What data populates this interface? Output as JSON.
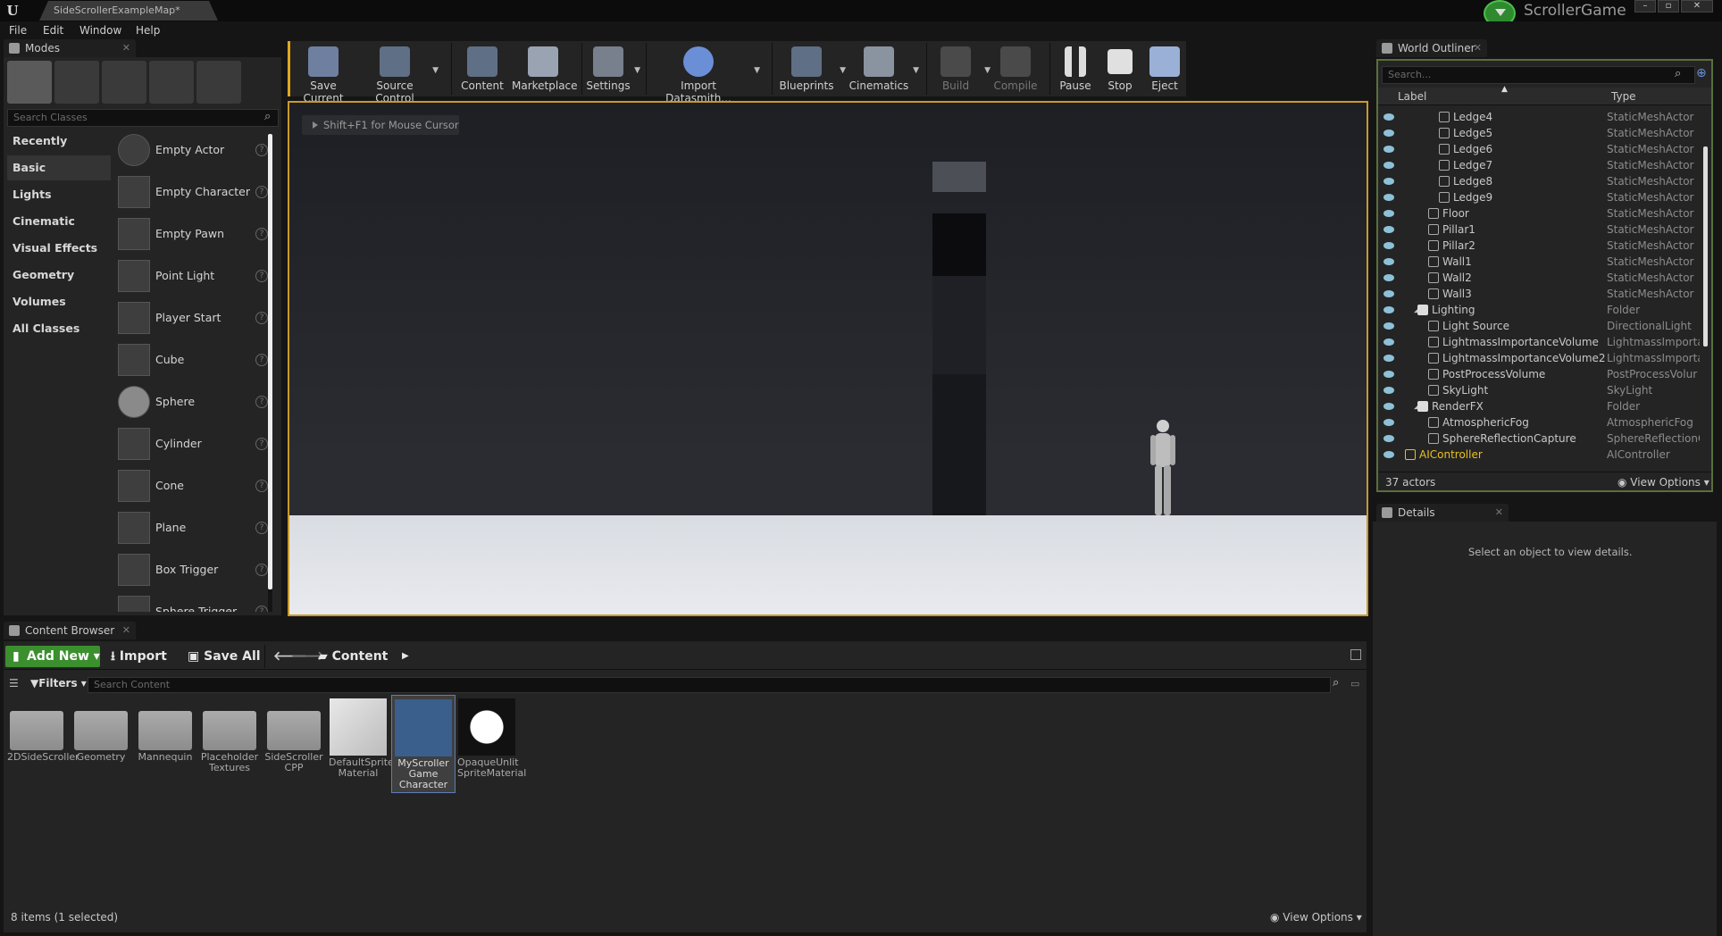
{
  "title_bar": {
    "tab": "SideScrollerExampleMap*",
    "game": "ScrollerGame",
    "minimize": "–",
    "maximize": "▫",
    "close": "✕"
  },
  "menu": [
    "File",
    "Edit",
    "Window",
    "Help"
  ],
  "modes": {
    "tab": "Modes",
    "search_placeholder": "Search Classes",
    "categories": [
      "Recently Placed",
      "Basic",
      "Lights",
      "Cinematic",
      "Visual Effects",
      "Geometry",
      "Volumes",
      "All Classes"
    ],
    "selected_category": "Basic",
    "items": [
      "Empty Actor",
      "Empty Character",
      "Empty Pawn",
      "Point Light",
      "Player Start",
      "Cube",
      "Sphere",
      "Cylinder",
      "Cone",
      "Plane",
      "Box Trigger",
      "Sphere Trigger"
    ]
  },
  "toolbar": [
    "Save Current",
    "Source Control",
    "Content",
    "Marketplace",
    "Settings",
    "Import Datasmith...",
    "Blueprints",
    "Cinematics",
    "Build",
    "Compile",
    "Pause",
    "Stop",
    "Eject"
  ],
  "viewport": {
    "hint": "Shift+F1 for Mouse Cursor"
  },
  "outliner": {
    "tab": "World Outliner",
    "search_placeholder": "Search...",
    "col_label": "Label",
    "col_type": "Type",
    "rows": [
      {
        "label": "Ledge4",
        "type": "StaticMeshActor"
      },
      {
        "label": "Ledge5",
        "type": "StaticMeshActor"
      },
      {
        "label": "Ledge6",
        "type": "StaticMeshActor"
      },
      {
        "label": "Ledge7",
        "type": "StaticMeshActor"
      },
      {
        "label": "Ledge8",
        "type": "StaticMeshActor"
      },
      {
        "label": "Ledge9",
        "type": "StaticMeshActor"
      },
      {
        "label": "Floor",
        "type": "StaticMeshActor"
      },
      {
        "label": "Pillar1",
        "type": "StaticMeshActor"
      },
      {
        "label": "Pillar2",
        "type": "StaticMeshActor"
      },
      {
        "label": "Wall1",
        "type": "StaticMeshActor"
      },
      {
        "label": "Wall2",
        "type": "StaticMeshActor"
      },
      {
        "label": "Wall3",
        "type": "StaticMeshActor"
      },
      {
        "label": "Lighting",
        "type": "Folder"
      },
      {
        "label": "Light Source",
        "type": "DirectionalLight"
      },
      {
        "label": "LightmassImportanceVolume",
        "type": "LightmassImporta"
      },
      {
        "label": "LightmassImportanceVolume2",
        "type": "LightmassImporta"
      },
      {
        "label": "PostProcessVolume",
        "type": "PostProcessVolur"
      },
      {
        "label": "SkyLight",
        "type": "SkyLight"
      },
      {
        "label": "RenderFX",
        "type": "Folder"
      },
      {
        "label": "AtmosphericFog",
        "type": "AtmosphericFog"
      },
      {
        "label": "SphereReflectionCapture",
        "type": "SphereReflectionC"
      },
      {
        "label": "AIController",
        "type": "AIController"
      }
    ],
    "count": "37 actors",
    "view_options": "View Options"
  },
  "details": {
    "tab": "Details",
    "empty_text": "Select an object to view details."
  },
  "content_browser": {
    "tab": "Content Browser",
    "add_new": "Add New",
    "import": "Import",
    "save_all": "Save All",
    "path": "Content",
    "filters": "Filters",
    "search_placeholder": "Search Content",
    "assets": [
      {
        "name": "2DSideScroller",
        "kind": "folder"
      },
      {
        "name": "Geometry",
        "kind": "folder"
      },
      {
        "name": "Mannequin",
        "kind": "folder"
      },
      {
        "name": "Placeholder Textures",
        "kind": "folder"
      },
      {
        "name": "SideScroller CPP",
        "kind": "folder"
      },
      {
        "name": "DefaultSprite Material",
        "kind": "material"
      },
      {
        "name": "MyScroller Game Character",
        "kind": "blueprint",
        "selected": true
      },
      {
        "name": "OpaqueUnlit SpriteMaterial",
        "kind": "material"
      }
    ],
    "status": "8 items (1 selected)",
    "view_options": "View Options"
  },
  "colors": {
    "accent_viewport": "#c89a2a",
    "add_new_green": "#3b8f2e",
    "selected_ai": "#e8c020"
  }
}
